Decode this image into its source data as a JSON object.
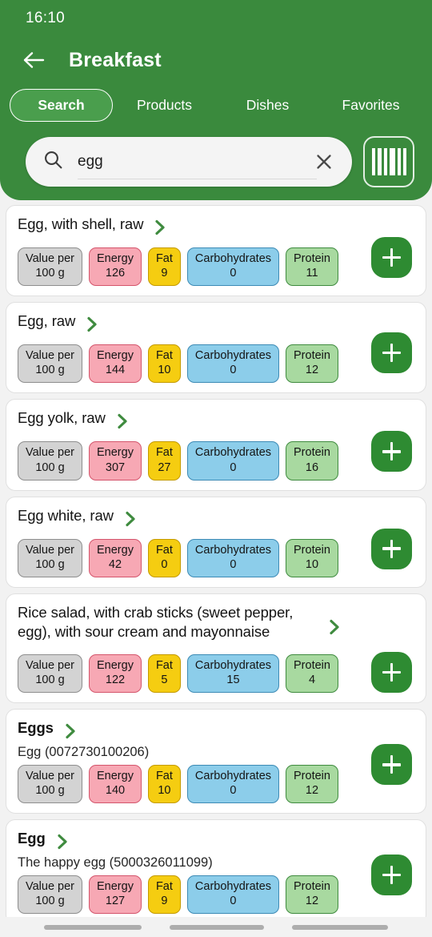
{
  "statusbar": {
    "time": "16:10"
  },
  "header": {
    "title": "Breakfast",
    "back_icon": "arrow-left-icon",
    "brand_green": "#3a8a3d",
    "tab_active_green": "#4a9e4d"
  },
  "tabs": [
    {
      "label": "Search",
      "active": true
    },
    {
      "label": "Products",
      "active": false
    },
    {
      "label": "Dishes",
      "active": false
    },
    {
      "label": "Favorites",
      "active": false
    }
  ],
  "search": {
    "value": "egg",
    "placeholder": "Search",
    "search_icon": "magnifier-icon",
    "clear_icon": "close-x-icon",
    "barcode_icon": "barcode-scan-icon"
  },
  "chip_labels": {
    "per": "Value per",
    "per_value": "100 g",
    "energy": "Energy",
    "fat": "Fat",
    "carbs": "Carbohydrates",
    "protein": "Protein"
  },
  "chip_colors": {
    "per": "#d3d3d3",
    "energy": "#f7a8b4",
    "fat": "#f5cd11",
    "carbs": "#8ccdea",
    "protein": "#a8d9a0",
    "add_button": "#2e8b32"
  },
  "add_button_label": "+",
  "results": [
    {
      "title": "Egg, with shell, raw",
      "subtitle": "",
      "per": "100 g",
      "energy": "126",
      "fat": "9",
      "carbs": "0",
      "protein": "11"
    },
    {
      "title": "Egg, raw",
      "subtitle": "",
      "per": "100 g",
      "energy": "144",
      "fat": "10",
      "carbs": "0",
      "protein": "12"
    },
    {
      "title": "Egg yolk, raw",
      "subtitle": "",
      "per": "100 g",
      "energy": "307",
      "fat": "27",
      "carbs": "0",
      "protein": "16"
    },
    {
      "title": "Egg white, raw",
      "subtitle": "",
      "per": "100 g",
      "energy": "42",
      "fat": "0",
      "carbs": "0",
      "protein": "10"
    },
    {
      "title": "Rice salad, with crab sticks (sweet pepper, egg), with sour cream and mayonnaise",
      "subtitle": "",
      "per": "100 g",
      "energy": "122",
      "fat": "5",
      "carbs": "15",
      "protein": "4"
    },
    {
      "title": "Eggs",
      "subtitle": "Egg (0072730100206)",
      "per": "100 g",
      "energy": "140",
      "fat": "10",
      "carbs": "0",
      "protein": "12"
    },
    {
      "title": "Egg",
      "subtitle": "The happy egg (5000326011099)",
      "per": "100 g",
      "energy": "127",
      "fat": "9",
      "carbs": "0",
      "protein": "12"
    }
  ],
  "sysnav": {
    "recents": "recents-button",
    "home": "home-button",
    "back": "back-button"
  }
}
